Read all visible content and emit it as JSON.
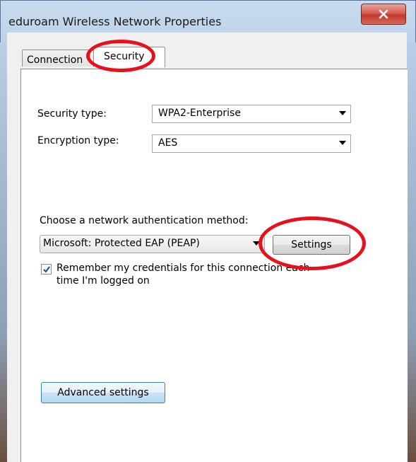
{
  "window": {
    "title": "eduroam Wireless Network Properties",
    "close_icon": "close-icon"
  },
  "tabs": [
    {
      "label": "Connection",
      "selected": false
    },
    {
      "label": "Security",
      "selected": true
    }
  ],
  "security": {
    "security_type_label": "Security type:",
    "security_type_value": "WPA2-Enterprise",
    "encryption_type_label": "Encryption type:",
    "encryption_type_value": "AES",
    "auth_method_label": "Choose a network authentication method:",
    "auth_method_value": "Microsoft: Protected EAP (PEAP)",
    "settings_button": "Settings",
    "remember_checkbox_label": "Remember my credentials for this connection each time I'm logged on",
    "remember_checked": true,
    "advanced_button": "Advanced settings"
  },
  "annotations": {
    "highlight_color": "#e8101a"
  }
}
